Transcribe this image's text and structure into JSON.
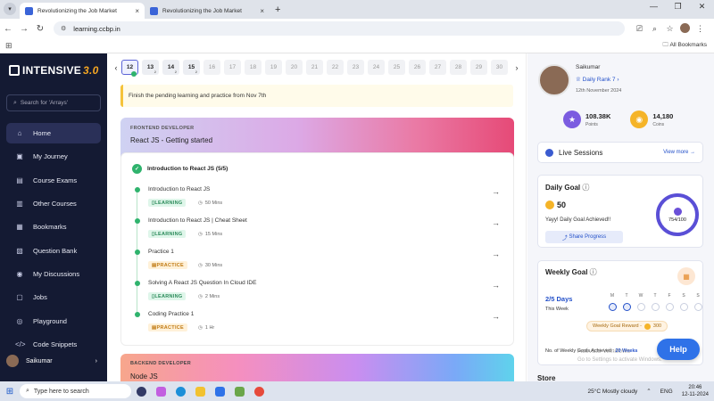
{
  "browser": {
    "tabs": [
      {
        "title": "Revolutionizing the Job Market"
      },
      {
        "title": "Revolutionizing the Job Market"
      }
    ],
    "url": "learning.ccbp.in",
    "all_bookmarks": "All Bookmarks"
  },
  "sidebar": {
    "logo_text": "INTENSIVE",
    "logo_version": "3.0",
    "search_placeholder": "Search for 'Arrays'",
    "items": [
      {
        "label": "Home",
        "icon": "home-icon"
      },
      {
        "label": "My Journey",
        "icon": "journey-icon"
      },
      {
        "label": "Course Exams",
        "icon": "exam-icon"
      },
      {
        "label": "Other Courses",
        "icon": "courses-icon"
      },
      {
        "label": "Bookmarks",
        "icon": "bookmark-icon"
      },
      {
        "label": "Question Bank",
        "icon": "question-bank-icon"
      },
      {
        "label": "My Discussions",
        "icon": "discussion-icon"
      },
      {
        "label": "Jobs",
        "icon": "jobs-icon"
      },
      {
        "label": "Playground",
        "icon": "playground-icon"
      },
      {
        "label": "Code Snippets",
        "icon": "code-icon"
      }
    ],
    "user_name": "Saikumar"
  },
  "days": {
    "list": [
      "12",
      "13",
      "14",
      "15",
      "16",
      "17",
      "18",
      "19",
      "20",
      "21",
      "22",
      "23",
      "24",
      "25",
      "26",
      "27",
      "28",
      "29",
      "30"
    ],
    "current": "12",
    "sub_marks": {
      "13": "2",
      "14": "2",
      "15": "2"
    }
  },
  "notice": "Finish the pending learning and practice from Nov 7th",
  "course_card": {
    "kicker": "FRONTEND DEVELOPER",
    "title": "React JS - Getting started",
    "module_title": "Introduction to React JS (5/5)",
    "items": [
      {
        "name": "Introduction to React JS",
        "tag": "LEARNING",
        "duration": "50 Mins"
      },
      {
        "name": "Introduction to React JS | Cheat Sheet",
        "tag": "LEARNING",
        "duration": "15 Mins"
      },
      {
        "name": "Practice 1",
        "tag": "PRACTICE",
        "duration": "30 Mins"
      },
      {
        "name": "Solving A React JS Question In Cloud IDE",
        "tag": "LEARNING",
        "duration": "2 Mins"
      },
      {
        "name": "Coding Practice 1",
        "tag": "PRACTICE",
        "duration": "1 Hr"
      }
    ]
  },
  "course_card2": {
    "kicker": "BACKEND DEVELOPER",
    "title": "Node JS"
  },
  "profile": {
    "name": "Saikumar",
    "rank": "Daily Rank 7",
    "date": "12th November 2024",
    "points_value": "108.38K",
    "points_label": "Points",
    "coins_value": "14,180",
    "coins_label": "Coins"
  },
  "live_sessions": {
    "title": "Live Sessions",
    "view_more": "View more"
  },
  "daily_goal": {
    "title": "Daily Goal",
    "coins": "50",
    "achieved": "Yayy! Daily Goal Achieved!!",
    "share": "Share Progress",
    "progress": "754/100"
  },
  "weekly_goal": {
    "title": "Weekly Goal",
    "days_done": "2/5 Days",
    "this_week": "This Week",
    "weekdays": [
      "M",
      "T",
      "W",
      "T",
      "F",
      "S",
      "S"
    ],
    "completed_days": 2,
    "reward_label": "Weekly Goal Reward -",
    "reward_value": "300",
    "achieved_label": "No. of Weekly Goals Achieved :",
    "achieved_value": "20 Weeks"
  },
  "store": "Store",
  "help": "Help",
  "watermark": {
    "line1": "Activate Windows",
    "line2": "Go to Settings to activate Windows."
  },
  "taskbar": {
    "search": "Type here to search",
    "weather": "25°C  Mostly cloudy",
    "lang": "ENG",
    "time": "20:46",
    "date": "12-11-2024"
  },
  "colors": {
    "sidebar_bg": "#141a33",
    "accent": "#2350c9",
    "success": "#2fb36d"
  }
}
